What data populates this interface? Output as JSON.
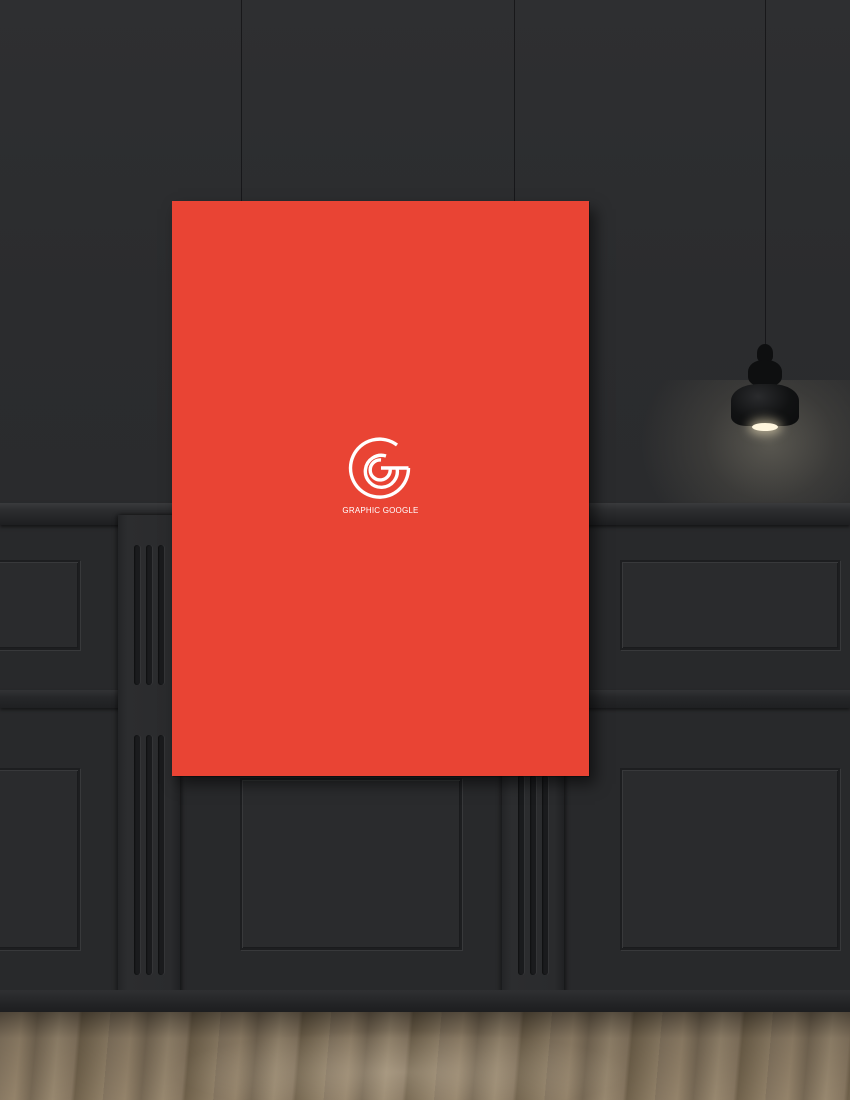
{
  "scene": {
    "wall_color": "#2b2c2e",
    "poster_color": "#e94434",
    "logo_color": "#ffffff"
  },
  "poster": {
    "logo_icon": "graphic-google-g-logo",
    "brand_text": "GRAPHIC GOOGLE"
  },
  "lamp": {
    "icon": "pendant-lamp"
  }
}
